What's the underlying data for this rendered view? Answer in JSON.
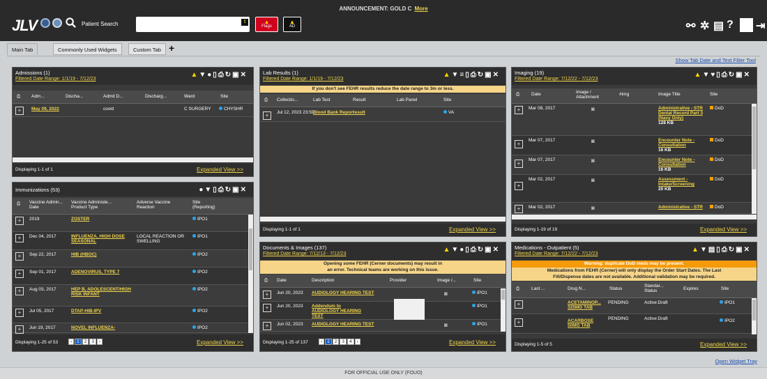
{
  "announcement": {
    "text": "ANNOUNCEMENT: GOLD C",
    "more": "More"
  },
  "header": {
    "logo": "JLV",
    "patient_search": "Patient Search",
    "flags_label": "Flags",
    "ad_label": "AD"
  },
  "tabs": [
    {
      "label": "Main Tab"
    },
    {
      "label": "Commonly Used Widgets"
    },
    {
      "label": "Custom Tab"
    }
  ],
  "show_tab_date": "Show Tab Date and Text Filter Tool",
  "admissions": {
    "title": "Admissions (1)",
    "subtitle": "Filtered Date Range: 1/1/19 - 7/12/23",
    "columns": [
      "Adm...",
      "Discha...",
      "Admit D...",
      "Discharg...",
      "Ward",
      "Site"
    ],
    "rows": [
      {
        "adm": "May 09, 2022",
        "admit": "covid",
        "ward": "C SURGERY",
        "site": "CHYSHR"
      }
    ],
    "displaying": "Displaying 1-1 of 1",
    "expanded": "Expanded View >>"
  },
  "immunizations": {
    "title": "Immunizations (53)",
    "columns": [
      "Vaccine Admin... Date",
      "Vaccine Administe... Product Type",
      "Adverse Vaccine Reaction",
      "Site (Reporting)"
    ],
    "rows": [
      {
        "date": "2019",
        "product": "ZOSTER",
        "reaction": "",
        "site": "IPO1"
      },
      {
        "date": "Dec 04, 2017",
        "product": "INFLUENZA, HIGH DOSE SEASONAL",
        "reaction": "LOCAL REACTION OR SWELLING",
        "site": "IPO1"
      },
      {
        "date": "Sep 22, 2017",
        "product": "HIB (HBOC)",
        "reaction": "",
        "site": "IPO2"
      },
      {
        "date": "Sep 01, 2017",
        "product": "ADENOVIRUS, TYPE 7",
        "reaction": "",
        "site": "IPO2"
      },
      {
        "date": "Aug 03, 2017",
        "product": "HEP B, ADOLESCENT/HIGH RISK INFANT",
        "reaction": "",
        "site": "IPO2"
      },
      {
        "date": "Jul 05, 2017",
        "product": "DTAP-HIB-IPV",
        "reaction": "",
        "site": "IPO2"
      },
      {
        "date": "Jun 19, 2017",
        "product": "NOVEL INFLUENZA-",
        "reaction": "",
        "site": "IPO2"
      }
    ],
    "displaying": "Displaying 1-25 of 53",
    "pages": [
      "1",
      "2",
      "3"
    ],
    "expanded": "Expanded View >>"
  },
  "labs": {
    "title": "Lab Results (1)",
    "subtitle": "Filtered Date Range: 1/1/19 - 7/12/23",
    "banner": "If you don't see FEHR results reduce the date range to 3m or less.",
    "columns": [
      "Collectio...",
      "Lab Test",
      "Result",
      "Lab Panel",
      "Site"
    ],
    "rows": [
      {
        "date": "Jul 12, 2023 23:59",
        "test": "Blood Bank Report",
        "result": "result",
        "site": "VA"
      }
    ],
    "displaying": "Displaying 1-1 of 1",
    "expanded": "Expanded View >>"
  },
  "documents": {
    "title": "Documents & Images (137)",
    "subtitle": "Filtered Date Range: 7/12/13 - 7/12/23",
    "banner": "Opening some FEHR (Cerner documents) may result in an error. Technical teams are working on this issue.",
    "columns": [
      "Date",
      "Description",
      "Provider",
      "Image /...",
      "Site"
    ],
    "rows": [
      {
        "date": "Jun 20, 2023",
        "desc": "AUDIOLOGY HEARING TEST",
        "site": "IPO1"
      },
      {
        "date": "Jun 20, 2023",
        "desc": "Addendum to AUDIOLOGY HEARING TEST",
        "site": "IPO1"
      },
      {
        "date": "Jun 02, 2023",
        "desc": "AUDIOLOGY HEARING TEST",
        "site": "IPO1"
      }
    ],
    "displaying": "Displaying 1-25 of 137",
    "pages": [
      "1",
      "2",
      "3",
      "4"
    ],
    "expanded": "Expanded View >>"
  },
  "imaging": {
    "title": "Imaging (19)",
    "subtitle": "Filtered Date Range: 7/12/22 - 7/12/23",
    "columns": [
      "Date",
      "Image / Attachment",
      "#img",
      "Image Title",
      "Site"
    ],
    "rows": [
      {
        "date": "Mar 08, 2017",
        "title": "Administrative - STR Dental Record Part 3 (Navy Only)",
        "size": "128 KB",
        "site": "DoD"
      },
      {
        "date": "Mar 07, 2017",
        "title": "Encounter Note - Consultation",
        "size": "16 KB",
        "site": "DoD"
      },
      {
        "date": "Mar 07, 2017",
        "title": "Encounter Note - Consultation",
        "size": "16 KB",
        "site": "DoD"
      },
      {
        "date": "Mar 02, 2017",
        "title": "Assessment - Intake/Screening",
        "size": "20 KB",
        "site": "DoD"
      },
      {
        "date": "Mar 02, 2017",
        "title": "Administrative - STR",
        "size": "",
        "site": "DoD"
      }
    ],
    "displaying": "Displaying 1-19 of 19",
    "expanded": "Expanded View >>"
  },
  "medications": {
    "title": "Medications - Outpatient (5)",
    "subtitle": "Filtered Date Range: 7/12/22 - 7/12/23",
    "banner_warn": "Warning: duplicate DoD meds may be present.",
    "banner": "Medications from FEHR (Cerner) will only display the Order Start Dates. The Last Fill/Dispense dates are not available. Additional validation may be required.",
    "columns": [
      "Last ...",
      "Drug N...",
      "Status",
      "Standar... Status",
      "Expires",
      "Site"
    ],
    "rows": [
      {
        "drug": "ACETAMINOP... 325MG TAB",
        "status": "PENDING",
        "std": "Active:Draft",
        "site": "IPO1"
      },
      {
        "drug": "ACARBOSE 50MG TAB",
        "status": "PENDING",
        "std": "Active:Draft",
        "site": "IPO2"
      }
    ],
    "displaying": "Displaying 1-5 of 5",
    "expanded": "Expanded View >>"
  },
  "footer": "FOR OFFICIAL USE ONLY (FOUO)",
  "open_tray": "Open Widget Tray"
}
